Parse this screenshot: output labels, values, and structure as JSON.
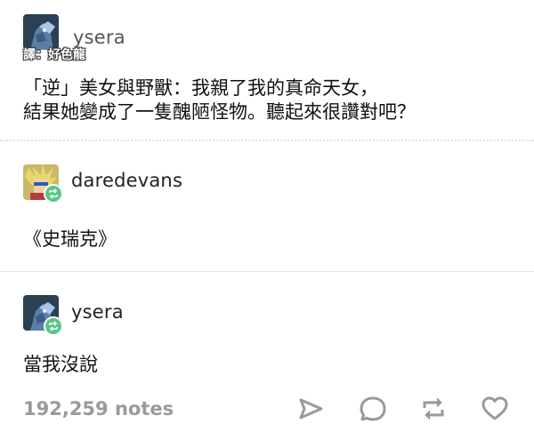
{
  "post": {
    "author": "ysera",
    "translator_credit": "譯：好色龍",
    "body_line1": "「逆」美女與野獸：我親了我的真命天女，",
    "body_line2": "結果她變成了一隻醜陋怪物。聽起來很讚對吧？"
  },
  "reblogs": [
    {
      "author": "daredevans",
      "text": "《史瑞克》"
    },
    {
      "author": "ysera",
      "text": "當我沒說"
    }
  ],
  "footer": {
    "notes": "192,259 notes",
    "icons": [
      "share-icon",
      "reply-icon",
      "reblog-icon",
      "like-icon"
    ]
  },
  "colors": {
    "reblog_green": "#57c785",
    "notes_gray": "#9a9a9a",
    "divider": "#e3e3e3"
  }
}
